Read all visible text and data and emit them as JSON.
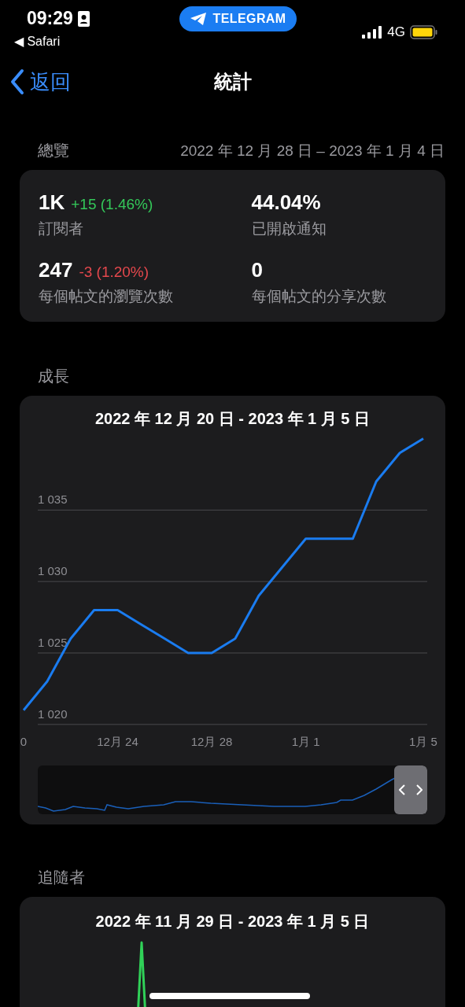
{
  "status_bar": {
    "time": "09:29",
    "back_app": "◀ Safari",
    "pill": "TELEGRAM",
    "network": "4G"
  },
  "nav": {
    "back": "返回",
    "title": "統計"
  },
  "overview": {
    "heading": "總覽",
    "range": "2022 年 12 月 28 日 – 2023 年 1 月 4 日",
    "stats": [
      {
        "value": "1K",
        "change": "+15 (1.46%)",
        "color": "#34c759",
        "label": "訂閱者"
      },
      {
        "value": "44.04%",
        "label": "已開啟通知"
      },
      {
        "value": "247",
        "change": "-3 (1.20%)",
        "color": "#e5484d",
        "label": "每個帖文的瀏覽次數"
      },
      {
        "value": "0",
        "label": "每個帖文的分享次數"
      }
    ]
  },
  "growth": {
    "heading": "成長",
    "title": "2022 年 12 月 20 日 - 2023 年 1 月 5 日",
    "chart_data": {
      "type": "line",
      "categories": [
        "0",
        null,
        null,
        null,
        "12月 24",
        null,
        null,
        null,
        "12月 28",
        null,
        null,
        null,
        "1月 1",
        null,
        null,
        null,
        null,
        "1月 5"
      ],
      "ylim": [
        1013,
        1043
      ],
      "grid": true,
      "yticks": [
        {
          "value": 1020,
          "label": "1 020"
        },
        {
          "value": 1025,
          "label": "1 025"
        },
        {
          "value": 1030,
          "label": "1 030"
        },
        {
          "value": 1035,
          "label": "1 035"
        }
      ],
      "series": [
        {
          "color": "#1a7cf0",
          "values": [
            1021,
            1023,
            1026,
            1028,
            1028,
            1027,
            1026,
            1025,
            1025,
            1026,
            1029,
            1031,
            1033,
            1033,
            1033,
            1037,
            1039,
            1040
          ]
        }
      ]
    }
  },
  "followers": {
    "heading": "追隨者",
    "title": "2022 年 11 月 29 日 - 2023 年 1 月 5 日"
  }
}
